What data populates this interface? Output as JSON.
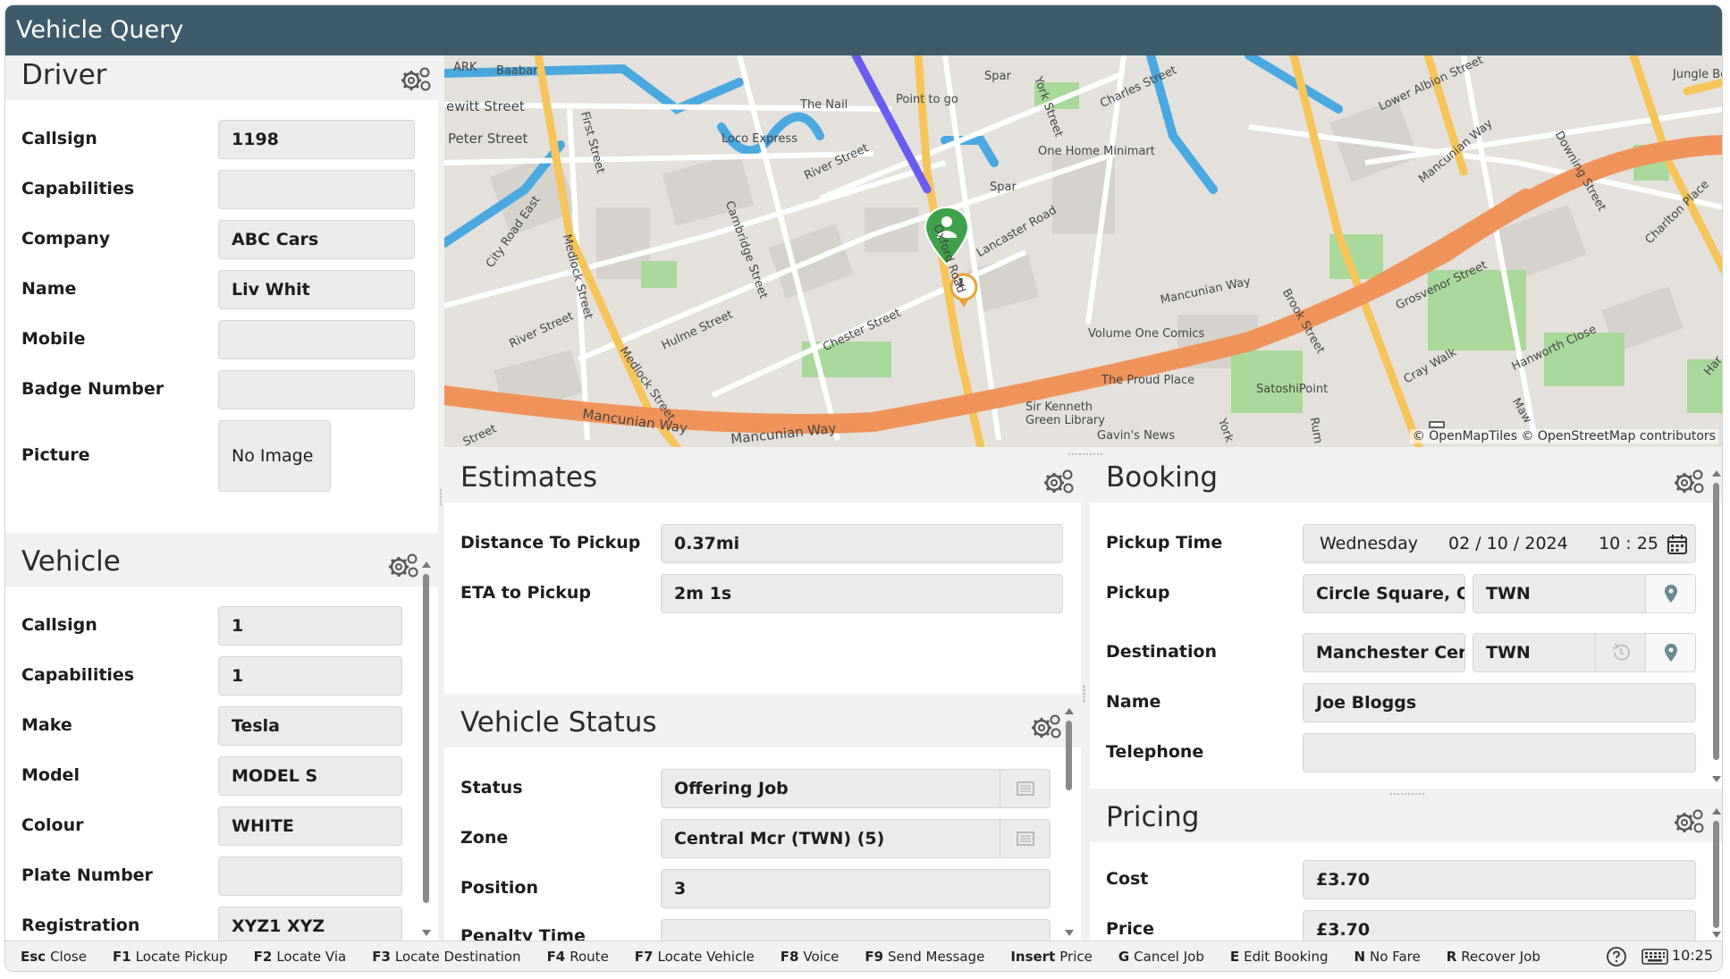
{
  "app": {
    "title": "Vehicle Query"
  },
  "driver": {
    "title": "Driver",
    "fields": [
      {
        "label": "Callsign",
        "value": "1198"
      },
      {
        "label": "Capabilities",
        "value": ""
      },
      {
        "label": "Company",
        "value": "ABC Cars"
      },
      {
        "label": "Name",
        "value": "Liv Whit"
      },
      {
        "label": "Mobile",
        "value": ""
      },
      {
        "label": "Badge Number",
        "value": ""
      }
    ],
    "picture_label": "Picture",
    "picture_value": "No Image"
  },
  "vehicle": {
    "title": "Vehicle",
    "fields": [
      {
        "label": "Callsign",
        "value": "1"
      },
      {
        "label": "Capabilities",
        "value": "1"
      },
      {
        "label": "Make",
        "value": "Tesla"
      },
      {
        "label": "Model",
        "value": "MODEL S"
      },
      {
        "label": "Colour",
        "value": "WHITE"
      },
      {
        "label": "Plate Number",
        "value": ""
      },
      {
        "label": "Registration",
        "value": "XYZ1 XYZ"
      }
    ]
  },
  "map": {
    "labels": [
      "ARK",
      "Baabar",
      "ewitt Street",
      "Peter Street",
      "The Nail",
      "Point to go",
      "Loco Express",
      "River Street",
      "First Street",
      "Spar",
      "One Home Minimart",
      "Spar",
      "York Street",
      "Charles Street",
      "Lower Albion Street",
      "Jungle Bee",
      "Mancunian Way",
      "Downing Street",
      "Charlton Place",
      "City Road East",
      "Medlock Street",
      "Cambridge Street",
      "Oxford Road",
      "Lancaster Road",
      "Mancunian Way",
      "Brook Street",
      "Grosvenor Street",
      "River Street",
      "Hulme Street",
      "Chester Street",
      "Volume One Comics",
      "Hanworth Close",
      "Cray Walk",
      "Medlock Street",
      "Mancunian Way",
      "The Proud Place",
      "SatoshiPoint",
      "Sir Kenneth Green Library",
      "Mancunian Way",
      "Street",
      "Gavin's News",
      "York",
      "Rum",
      "Maw",
      "Har"
    ],
    "marker_badge": "1",
    "attribution": "© OpenMapTiles © OpenStreetMap contributors"
  },
  "estimates": {
    "title": "Estimates",
    "fields": [
      {
        "label": "Distance To Pickup",
        "value": "0.37mi"
      },
      {
        "label": "ETA to Pickup",
        "value": "2m 1s"
      }
    ]
  },
  "vehicle_status": {
    "title": "Vehicle Status",
    "fields": [
      {
        "label": "Status",
        "value": "Offering Job"
      },
      {
        "label": "Zone",
        "value": "Central Mcr (TWN) (5)"
      },
      {
        "label": "Position",
        "value": "3"
      },
      {
        "label": "Penalty Time",
        "value": ""
      }
    ]
  },
  "booking": {
    "title": "Booking",
    "pickup_time_label": "Pickup Time",
    "pickup_time": {
      "day": "Wednesday",
      "date": "02 / 10 / 2024",
      "time": "10 : 25"
    },
    "pickup_label": "Pickup",
    "pickup_address": "Circle Square, O",
    "pickup_zone": "TWN",
    "destination_label": "Destination",
    "destination_address": "Manchester Cer",
    "destination_zone": "TWN",
    "name_label": "Name",
    "name_value": "Joe Bloggs",
    "telephone_label": "Telephone",
    "telephone_value": ""
  },
  "pricing": {
    "title": "Pricing",
    "fields": [
      {
        "label": "Cost",
        "value": "£3.70"
      },
      {
        "label": "Price",
        "value": "£3.70"
      }
    ]
  },
  "footer": {
    "keys": [
      {
        "key": "Esc",
        "label": "Close"
      },
      {
        "key": "F1",
        "label": "Locate Pickup"
      },
      {
        "key": "F2",
        "label": "Locate Via"
      },
      {
        "key": "F3",
        "label": "Locate Destination"
      },
      {
        "key": "F4",
        "label": "Route"
      },
      {
        "key": "F7",
        "label": "Locate Vehicle"
      },
      {
        "key": "F8",
        "label": "Voice"
      },
      {
        "key": "F9",
        "label": "Send Message"
      },
      {
        "key": "Insert",
        "label": "Price"
      },
      {
        "key": "G",
        "label": "Cancel Job"
      },
      {
        "key": "E",
        "label": "Edit Booking"
      },
      {
        "key": "N",
        "label": "No Fare"
      },
      {
        "key": "R",
        "label": "Recover Job"
      }
    ],
    "clock": "10:25"
  },
  "icons": [
    "gear-icon",
    "calendar-icon",
    "location-pin-icon",
    "history-icon",
    "list-icon",
    "help-icon",
    "keyboard-icon",
    "driver-marker-icon"
  ],
  "colors": {
    "titlebar": "#3e5b6c",
    "route": "#6b5cf0",
    "road_major": "#f0935a",
    "road_secondary": "#f5c55c",
    "water": "#4aa8e0",
    "park": "#a8d99a",
    "marker": "#3fa24a"
  }
}
